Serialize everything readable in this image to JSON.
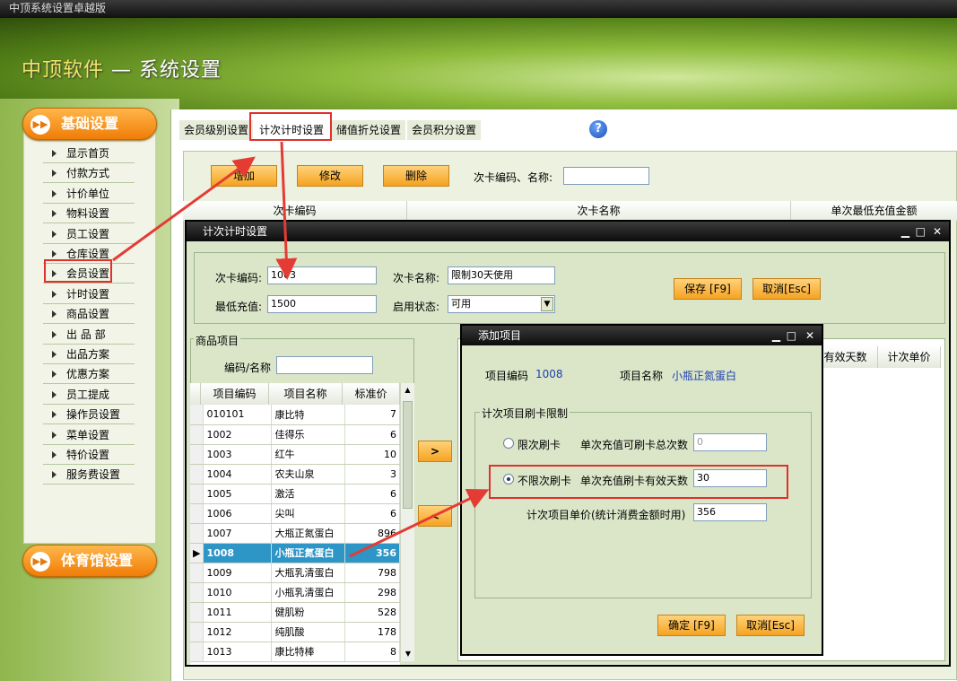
{
  "app": {
    "window_title": "中顶系统设置卓越版",
    "brand": "中顶软件",
    "dash": "—",
    "section": "系统设置"
  },
  "sidebar": {
    "group1": "基础设置",
    "items": [
      "显示首页",
      "付款方式",
      "计价单位",
      "物料设置",
      "员工设置",
      "仓库设置",
      "会员设置",
      "计时设置",
      "商品设置",
      "出 品 部",
      "出品方案",
      "优惠方案",
      "员工提成",
      "操作员设置",
      "菜单设置",
      "特价设置",
      "服务费设置"
    ],
    "group2": "体育馆设置"
  },
  "tabs": [
    {
      "label": "会员级别设置"
    },
    {
      "label": "计次计时设置"
    },
    {
      "label": "储值折兑设置"
    },
    {
      "label": "会员积分设置"
    }
  ],
  "help_icon": "?",
  "toolbar": {
    "add": "增加",
    "edit": "修改",
    "delete": "删除",
    "search_label": "次卡编码、名称:",
    "search_value": ""
  },
  "main_grid": {
    "columns": [
      "次卡编码",
      "次卡名称",
      "单次最低充值金额"
    ]
  },
  "card_dialog": {
    "title": "计次计时设置",
    "code_label": "次卡编码:",
    "code_value": "1003",
    "name_label": "次卡名称:",
    "name_value": "限制30天使用",
    "min_label": "最低充值:",
    "min_value": "1500",
    "status_label": "启用状态:",
    "status_value": "可用",
    "save": "保存 [F9]",
    "cancel": "取消[Esc]",
    "products_group": "商品项目",
    "filter_label": "编码/名称",
    "filter_value": "",
    "product_columns": [
      "项目编码",
      "项目名称",
      "标准价"
    ],
    "products": [
      {
        "code": "010101",
        "name": "康比特",
        "price": "7"
      },
      {
        "code": "1002",
        "name": "佳得乐",
        "price": "6"
      },
      {
        "code": "1003",
        "name": "红牛",
        "price": "10"
      },
      {
        "code": "1004",
        "name": "农夫山泉",
        "price": "3"
      },
      {
        "code": "1005",
        "name": "激活",
        "price": "6"
      },
      {
        "code": "1006",
        "name": "尖叫",
        "price": "6"
      },
      {
        "code": "1007",
        "name": "大瓶正氮蛋白",
        "price": "896"
      },
      {
        "code": "1008",
        "name": "小瓶正氮蛋白",
        "price": "356"
      },
      {
        "code": "1009",
        "name": "大瓶乳清蛋白",
        "price": "798"
      },
      {
        "code": "1010",
        "name": "小瓶乳清蛋白",
        "price": "298"
      },
      {
        "code": "1011",
        "name": "健肌粉",
        "price": "528"
      },
      {
        "code": "1012",
        "name": "纯肌酸",
        "price": "178"
      },
      {
        "code": "1013",
        "name": "康比特棒",
        "price": "8"
      }
    ],
    "selected_index": 7,
    "move_right": ">",
    "move_left": "<",
    "right_columns": [
      "有效天数",
      "计次单价"
    ]
  },
  "add_dialog": {
    "title": "添加项目",
    "item_code_label": "项目编码",
    "item_code": "1008",
    "item_name_label": "项目名称",
    "item_name": "小瓶正氮蛋白",
    "limit_group": "计次项目刷卡限制",
    "opt_limited": "限次刷卡",
    "limited_label": "单次充值可刷卡总次数",
    "limited_value": "0",
    "opt_unlimited": "不限次刷卡",
    "unlimited_label": "单次充值刷卡有效天数",
    "unlimited_value": "30",
    "price_label": "计次项目单价(统计消费金额时用)",
    "price_value": "356",
    "ok": "确定 [F9]",
    "cancel": "取消[Esc]"
  },
  "window_controls": {
    "minimize": "▁",
    "maximize": "□",
    "close": "✕"
  }
}
